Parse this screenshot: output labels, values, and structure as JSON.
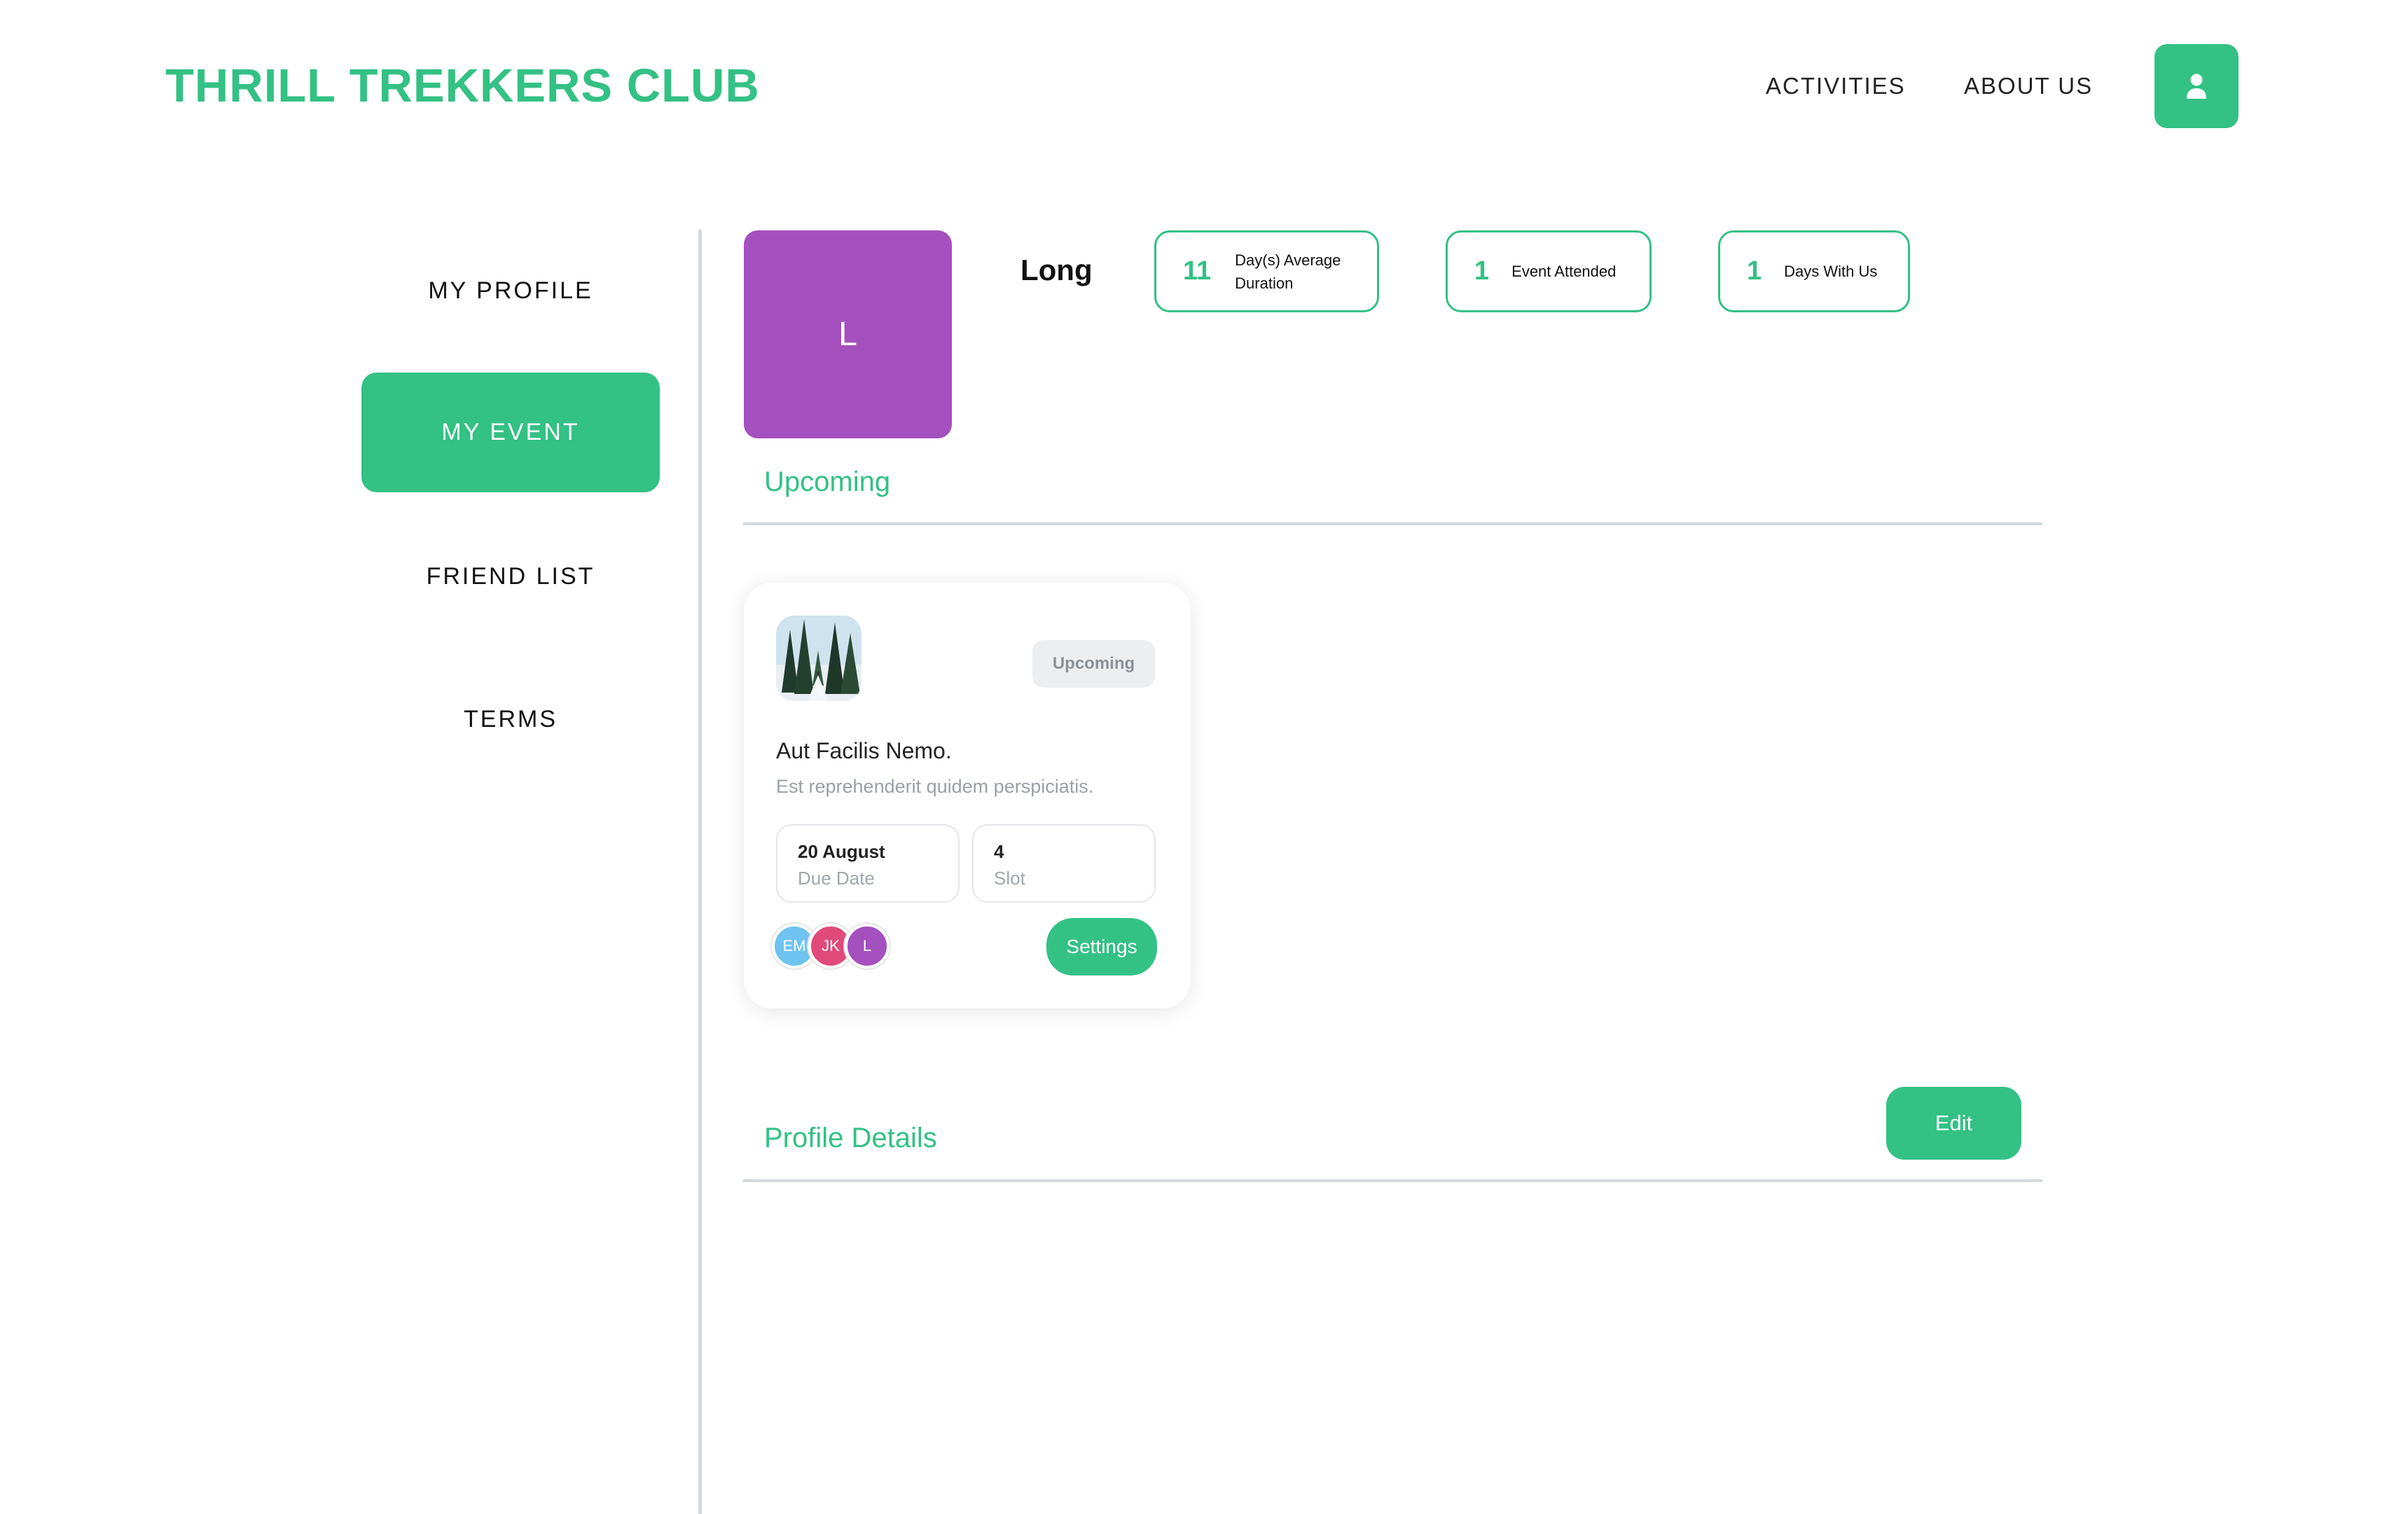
{
  "header": {
    "logo": "THRILL TREKKERS CLUB",
    "nav": [
      "ACTIVITIES",
      "ABOUT US"
    ],
    "user_icon": "user-icon"
  },
  "sidebar": {
    "items": [
      {
        "label": "MY PROFILE",
        "active": false
      },
      {
        "label": "MY EVENT",
        "active": true
      },
      {
        "label": "FRIEND LIST",
        "active": false
      },
      {
        "label": "TERMS",
        "active": false
      }
    ]
  },
  "profile": {
    "initial": "L",
    "name": "Long",
    "stats": [
      {
        "value": "11",
        "label": "Day(s) Average Duration"
      },
      {
        "value": "1",
        "label": "Event Attended"
      },
      {
        "value": "1",
        "label": "Days With Us"
      }
    ]
  },
  "upcoming": {
    "title": "Upcoming",
    "card": {
      "badge": "Upcoming",
      "title": "Aut Facilis Nemo.",
      "description": "Est reprehenderit quidem perspiciatis.",
      "due_value": "20 August",
      "due_label": "Due Date",
      "slot_value": "4",
      "slot_label": "Slot",
      "participants": [
        {
          "initials": "EM",
          "color": "#6ec3f0"
        },
        {
          "initials": "JK",
          "color": "#e04a7a"
        },
        {
          "initials": "L",
          "color": "#a450bf"
        }
      ],
      "settings_label": "Settings"
    }
  },
  "profile_details": {
    "title": "Profile Details",
    "edit_label": "Edit"
  },
  "colors": {
    "accent": "#33c184",
    "avatar": "#a450bf",
    "divider": "#d4d9dc"
  }
}
